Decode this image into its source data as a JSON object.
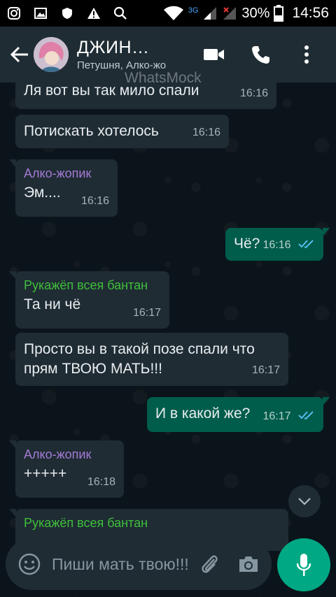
{
  "status_bar": {
    "network": "3G",
    "battery": "30%",
    "time": "14:56"
  },
  "header": {
    "title": "ДЖИН…",
    "subtitle": "Петушня, Алко-жо"
  },
  "watermark": "WhatsMock",
  "messages": [
    {
      "dir": "in",
      "sender": "",
      "text": "Ля вот вы так мило спали",
      "time": "16:16"
    },
    {
      "dir": "in",
      "sender": "",
      "text": "Потискать хотелось",
      "time": "16:16"
    },
    {
      "dir": "in",
      "sender": "Алко-жопик",
      "sender_color": "#a67ad5",
      "text": "Эм....",
      "time": "16:16"
    },
    {
      "dir": "out",
      "sender": "",
      "text": "Чё?",
      "time": "16:16"
    },
    {
      "dir": "in",
      "sender": "Рукажёп всея бантан",
      "sender_color": "#3fbf3a",
      "text": "Та ни чё",
      "time": "16:17"
    },
    {
      "dir": "in",
      "sender": "",
      "text": "Просто вы в такой позе спали что прям ТВОЮ МАТЬ!!!",
      "time": "16:17"
    },
    {
      "dir": "out",
      "sender": "",
      "text": "И в какой же?",
      "time": "16:17"
    },
    {
      "dir": "in",
      "sender": "Алко-жопик",
      "sender_color": "#a67ad5",
      "text": "+++++",
      "time": "16:18"
    },
    {
      "dir": "in",
      "sender": "Рукажёп всея бантан",
      "sender_color": "#3fbf3a",
      "text": "",
      "time": ""
    }
  ],
  "composer": {
    "placeholder": "Пиши мать твою!!!"
  },
  "colors": {
    "incoming_bubble": "#1f2c34",
    "outgoing_bubble": "#005c4b",
    "accent": "#00a884",
    "read_ticks": "#53bdeb"
  }
}
